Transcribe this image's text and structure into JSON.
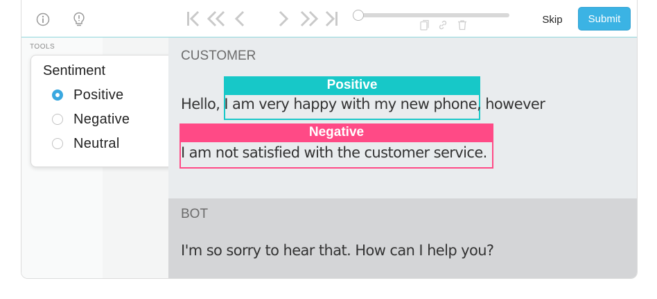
{
  "toolbar": {
    "skip_label": "Skip",
    "submit_label": "Submit"
  },
  "sidebar": {
    "tools_label": "TOOLS",
    "panel": {
      "title": "Sentiment",
      "options": [
        {
          "label": "Positive",
          "selected": true
        },
        {
          "label": "Negative",
          "selected": false
        },
        {
          "label": "Neutral",
          "selected": false
        }
      ]
    }
  },
  "conversation": {
    "customer": {
      "role": "CUSTOMER",
      "line1": "Hello, I am very happy with my new phone, however",
      "line2": "I am not satisfied with the customer service."
    },
    "bot": {
      "role": "BOT",
      "text": "I'm so sorry to hear that. How can I help you?"
    }
  },
  "annotations": [
    {
      "label": "Positive",
      "text": "I am very happy with my new phone",
      "color": "#17c8c8"
    },
    {
      "label": "Negative",
      "text": "I am not satisfied with the customer service",
      "color": "#ff4a86"
    }
  ],
  "colors": {
    "accent": "#3bb3e4",
    "positive": "#17c8c8",
    "negative": "#ff4a86"
  },
  "icons": [
    "info-icon",
    "lightbulb-icon",
    "first-icon",
    "rewind-icon",
    "prev-icon",
    "next-icon",
    "fast-forward-icon",
    "last-icon",
    "copy-icon",
    "link-icon",
    "trash-icon"
  ]
}
